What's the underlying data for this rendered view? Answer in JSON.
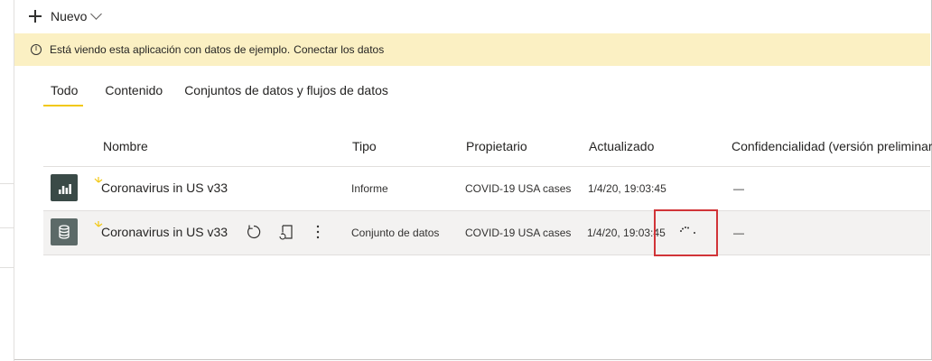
{
  "toolbar": {
    "new_label": "Nuevo"
  },
  "banner": {
    "message": "Está viendo esta aplicación con datos de ejemplo.",
    "link": "Conectar los datos"
  },
  "tabs": [
    {
      "label": "Todo",
      "active": true
    },
    {
      "label": "Contenido",
      "active": false
    },
    {
      "label": "Conjuntos de datos y flujos de datos",
      "active": false
    }
  ],
  "table": {
    "columns": {
      "name": "Nombre",
      "type": "Tipo",
      "owner": "Propietario",
      "updated": "Actualizado",
      "sensitivity": "Confidencialidad (versión preliminar)"
    },
    "rows": [
      {
        "icon": "report-icon",
        "name": "Coronavirus in US v33",
        "type": "Informe",
        "owner": "COVID-19 USA cases",
        "updated": "1/4/20, 19:03:45",
        "sensitivity": "—"
      },
      {
        "icon": "dataset-icon",
        "name": "Coronavirus in US v33",
        "type": "Conjunto de datos",
        "owner": "COVID-19 USA cases",
        "updated": "1/4/20, 19:03:45",
        "sensitivity": "—"
      }
    ]
  },
  "colors": {
    "accent": "#f2c811",
    "banner_bg": "#fbf0c3",
    "highlight": "#d13438",
    "report_tile": "#3a4a47",
    "dataset_tile": "#5c6a68"
  }
}
